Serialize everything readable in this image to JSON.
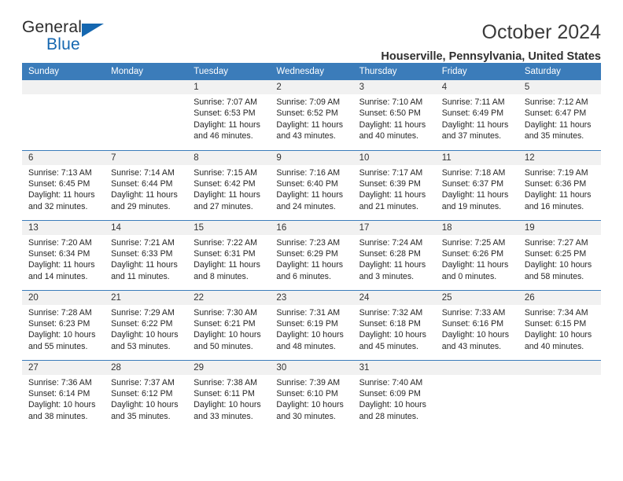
{
  "logo": {
    "name_part1": "General",
    "name_part2": "Blue",
    "triangle_color": "#1567b0"
  },
  "header": {
    "title": "October 2024",
    "location": "Houserville, Pennsylvania, United States"
  },
  "theme": {
    "header_blue": "#3b7cba",
    "daynum_gray": "#f1f1f1"
  },
  "calendar": {
    "weekday_headers": [
      "Sunday",
      "Monday",
      "Tuesday",
      "Wednesday",
      "Thursday",
      "Friday",
      "Saturday"
    ],
    "weeks": [
      [
        {
          "day": "",
          "blank": true,
          "sunrise": "",
          "sunset": "",
          "daylight1": "",
          "daylight2": ""
        },
        {
          "day": "",
          "blank": true,
          "sunrise": "",
          "sunset": "",
          "daylight1": "",
          "daylight2": ""
        },
        {
          "day": "1",
          "sunrise": "Sunrise: 7:07 AM",
          "sunset": "Sunset: 6:53 PM",
          "daylight1": "Daylight: 11 hours",
          "daylight2": "and 46 minutes."
        },
        {
          "day": "2",
          "sunrise": "Sunrise: 7:09 AM",
          "sunset": "Sunset: 6:52 PM",
          "daylight1": "Daylight: 11 hours",
          "daylight2": "and 43 minutes."
        },
        {
          "day": "3",
          "sunrise": "Sunrise: 7:10 AM",
          "sunset": "Sunset: 6:50 PM",
          "daylight1": "Daylight: 11 hours",
          "daylight2": "and 40 minutes."
        },
        {
          "day": "4",
          "sunrise": "Sunrise: 7:11 AM",
          "sunset": "Sunset: 6:49 PM",
          "daylight1": "Daylight: 11 hours",
          "daylight2": "and 37 minutes."
        },
        {
          "day": "5",
          "sunrise": "Sunrise: 7:12 AM",
          "sunset": "Sunset: 6:47 PM",
          "daylight1": "Daylight: 11 hours",
          "daylight2": "and 35 minutes."
        }
      ],
      [
        {
          "day": "6",
          "sunrise": "Sunrise: 7:13 AM",
          "sunset": "Sunset: 6:45 PM",
          "daylight1": "Daylight: 11 hours",
          "daylight2": "and 32 minutes."
        },
        {
          "day": "7",
          "sunrise": "Sunrise: 7:14 AM",
          "sunset": "Sunset: 6:44 PM",
          "daylight1": "Daylight: 11 hours",
          "daylight2": "and 29 minutes."
        },
        {
          "day": "8",
          "sunrise": "Sunrise: 7:15 AM",
          "sunset": "Sunset: 6:42 PM",
          "daylight1": "Daylight: 11 hours",
          "daylight2": "and 27 minutes."
        },
        {
          "day": "9",
          "sunrise": "Sunrise: 7:16 AM",
          "sunset": "Sunset: 6:40 PM",
          "daylight1": "Daylight: 11 hours",
          "daylight2": "and 24 minutes."
        },
        {
          "day": "10",
          "sunrise": "Sunrise: 7:17 AM",
          "sunset": "Sunset: 6:39 PM",
          "daylight1": "Daylight: 11 hours",
          "daylight2": "and 21 minutes."
        },
        {
          "day": "11",
          "sunrise": "Sunrise: 7:18 AM",
          "sunset": "Sunset: 6:37 PM",
          "daylight1": "Daylight: 11 hours",
          "daylight2": "and 19 minutes."
        },
        {
          "day": "12",
          "sunrise": "Sunrise: 7:19 AM",
          "sunset": "Sunset: 6:36 PM",
          "daylight1": "Daylight: 11 hours",
          "daylight2": "and 16 minutes."
        }
      ],
      [
        {
          "day": "13",
          "sunrise": "Sunrise: 7:20 AM",
          "sunset": "Sunset: 6:34 PM",
          "daylight1": "Daylight: 11 hours",
          "daylight2": "and 14 minutes."
        },
        {
          "day": "14",
          "sunrise": "Sunrise: 7:21 AM",
          "sunset": "Sunset: 6:33 PM",
          "daylight1": "Daylight: 11 hours",
          "daylight2": "and 11 minutes."
        },
        {
          "day": "15",
          "sunrise": "Sunrise: 7:22 AM",
          "sunset": "Sunset: 6:31 PM",
          "daylight1": "Daylight: 11 hours",
          "daylight2": "and 8 minutes."
        },
        {
          "day": "16",
          "sunrise": "Sunrise: 7:23 AM",
          "sunset": "Sunset: 6:29 PM",
          "daylight1": "Daylight: 11 hours",
          "daylight2": "and 6 minutes."
        },
        {
          "day": "17",
          "sunrise": "Sunrise: 7:24 AM",
          "sunset": "Sunset: 6:28 PM",
          "daylight1": "Daylight: 11 hours",
          "daylight2": "and 3 minutes."
        },
        {
          "day": "18",
          "sunrise": "Sunrise: 7:25 AM",
          "sunset": "Sunset: 6:26 PM",
          "daylight1": "Daylight: 11 hours",
          "daylight2": "and 0 minutes."
        },
        {
          "day": "19",
          "sunrise": "Sunrise: 7:27 AM",
          "sunset": "Sunset: 6:25 PM",
          "daylight1": "Daylight: 10 hours",
          "daylight2": "and 58 minutes."
        }
      ],
      [
        {
          "day": "20",
          "sunrise": "Sunrise: 7:28 AM",
          "sunset": "Sunset: 6:23 PM",
          "daylight1": "Daylight: 10 hours",
          "daylight2": "and 55 minutes."
        },
        {
          "day": "21",
          "sunrise": "Sunrise: 7:29 AM",
          "sunset": "Sunset: 6:22 PM",
          "daylight1": "Daylight: 10 hours",
          "daylight2": "and 53 minutes."
        },
        {
          "day": "22",
          "sunrise": "Sunrise: 7:30 AM",
          "sunset": "Sunset: 6:21 PM",
          "daylight1": "Daylight: 10 hours",
          "daylight2": "and 50 minutes."
        },
        {
          "day": "23",
          "sunrise": "Sunrise: 7:31 AM",
          "sunset": "Sunset: 6:19 PM",
          "daylight1": "Daylight: 10 hours",
          "daylight2": "and 48 minutes."
        },
        {
          "day": "24",
          "sunrise": "Sunrise: 7:32 AM",
          "sunset": "Sunset: 6:18 PM",
          "daylight1": "Daylight: 10 hours",
          "daylight2": "and 45 minutes."
        },
        {
          "day": "25",
          "sunrise": "Sunrise: 7:33 AM",
          "sunset": "Sunset: 6:16 PM",
          "daylight1": "Daylight: 10 hours",
          "daylight2": "and 43 minutes."
        },
        {
          "day": "26",
          "sunrise": "Sunrise: 7:34 AM",
          "sunset": "Sunset: 6:15 PM",
          "daylight1": "Daylight: 10 hours",
          "daylight2": "and 40 minutes."
        }
      ],
      [
        {
          "day": "27",
          "sunrise": "Sunrise: 7:36 AM",
          "sunset": "Sunset: 6:14 PM",
          "daylight1": "Daylight: 10 hours",
          "daylight2": "and 38 minutes."
        },
        {
          "day": "28",
          "sunrise": "Sunrise: 7:37 AM",
          "sunset": "Sunset: 6:12 PM",
          "daylight1": "Daylight: 10 hours",
          "daylight2": "and 35 minutes."
        },
        {
          "day": "29",
          "sunrise": "Sunrise: 7:38 AM",
          "sunset": "Sunset: 6:11 PM",
          "daylight1": "Daylight: 10 hours",
          "daylight2": "and 33 minutes."
        },
        {
          "day": "30",
          "sunrise": "Sunrise: 7:39 AM",
          "sunset": "Sunset: 6:10 PM",
          "daylight1": "Daylight: 10 hours",
          "daylight2": "and 30 minutes."
        },
        {
          "day": "31",
          "sunrise": "Sunrise: 7:40 AM",
          "sunset": "Sunset: 6:09 PM",
          "daylight1": "Daylight: 10 hours",
          "daylight2": "and 28 minutes."
        },
        {
          "day": "",
          "blank": true,
          "sunrise": "",
          "sunset": "",
          "daylight1": "",
          "daylight2": ""
        },
        {
          "day": "",
          "blank": true,
          "sunrise": "",
          "sunset": "",
          "daylight1": "",
          "daylight2": ""
        }
      ]
    ]
  }
}
